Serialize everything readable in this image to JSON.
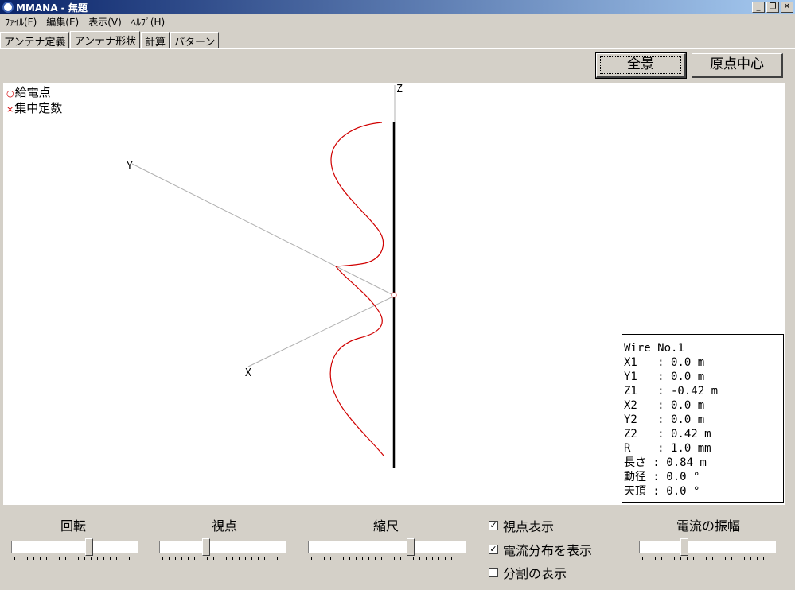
{
  "window": {
    "title": "MMANA - 無題"
  },
  "menu": [
    "ﾌｧｲﾙ(F)",
    "編集(E)",
    "表示(V)",
    "ﾍﾙﾌﾟ(H)"
  ],
  "tabs": [
    {
      "label": "アンテナ定義",
      "active": false
    },
    {
      "label": "アンテナ形状",
      "active": true
    },
    {
      "label": "計算",
      "active": false
    },
    {
      "label": "パターン",
      "active": false
    }
  ],
  "buttons": {
    "full_view": "全景",
    "origin_center": "原点中心"
  },
  "legend": {
    "feed_point": "給電点",
    "lumped_constant": "集中定数"
  },
  "axes": {
    "x": "X",
    "y": "Y",
    "z": "Z"
  },
  "wire_info": [
    "Wire No.1",
    "X1   : 0.0 m",
    "Y1   : 0.0 m",
    "Z1   : -0.42 m",
    "X2   : 0.0 m",
    "Y2   : 0.0 m",
    "Z2   : 0.42 m",
    "R    : 1.0 mm",
    "長さ : 0.84 m",
    "動径 : 0.0 °",
    "天頂 : 0.0 °"
  ],
  "controls": {
    "rotation": {
      "label": "回転",
      "value": 0.62
    },
    "viewpoint": {
      "label": "視点",
      "value": 0.36
    },
    "scale": {
      "label": "縮尺",
      "value": 0.66
    },
    "current_amplitude": {
      "label": "電流の振幅",
      "value": 0.32
    }
  },
  "checkboxes": [
    {
      "label": "視点表示",
      "checked": true
    },
    {
      "label": "電流分布を表示",
      "checked": true
    },
    {
      "label": "分割の表示",
      "checked": false
    }
  ],
  "colors": {
    "title_start": "#0a246a",
    "title_end": "#a6caf0",
    "current": "#d00000",
    "wire": "#000000"
  }
}
